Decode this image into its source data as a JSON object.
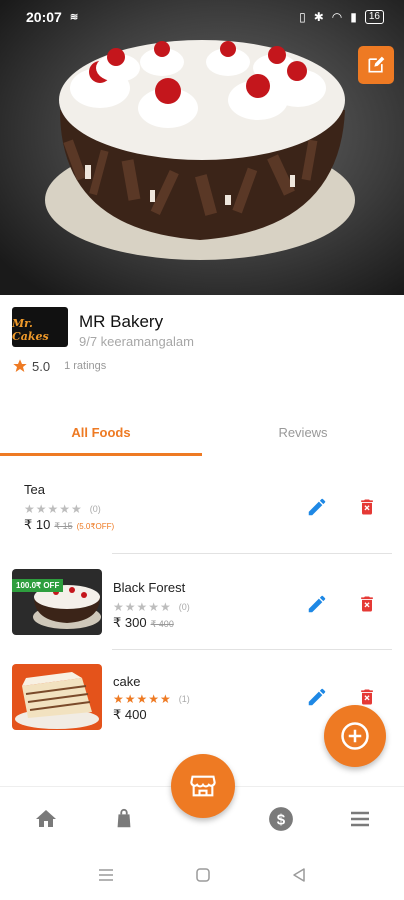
{
  "status_bar": {
    "time": "20:07",
    "battery": "16"
  },
  "store": {
    "logo_text": "Mr. Cakes",
    "name": "MR Bakery",
    "address": "9/7 keeramangalam",
    "rating": "5.0",
    "rating_count": "1 ratings"
  },
  "tabs": [
    {
      "label": "All Foods",
      "active": true
    },
    {
      "label": "Reviews",
      "active": false
    }
  ],
  "foods": [
    {
      "name": "Tea",
      "rating_count": "(0)",
      "stars_filled": 0,
      "price": "₹ 10",
      "old_price": "₹ 15",
      "discount": "(5.0₹OFF)",
      "has_image": false
    },
    {
      "name": "Black Forest",
      "rating_count": "(0)",
      "stars_filled": 0,
      "price": "₹ 300",
      "old_price": "₹ 400",
      "badge": "100.0₹ OFF",
      "has_image": true
    },
    {
      "name": "cake",
      "rating_count": "(1)",
      "stars_filled": 5,
      "price": "₹ 400",
      "has_image": true
    }
  ],
  "colors": {
    "accent": "#ee7a23",
    "edit_blue": "#1e88e5",
    "delete_red": "#e53935",
    "badge_green": "#2e9e3e"
  },
  "icons": {
    "edit_store": "edit-square-icon",
    "edit_food": "pencil-icon",
    "delete_food": "trash-icon",
    "add": "plus-circle-icon",
    "nav_home": "home-icon",
    "nav_orders": "shopping-bag-icon",
    "nav_store": "storefront-icon",
    "nav_earnings": "dollar-icon",
    "nav_menu": "menu-icon"
  }
}
